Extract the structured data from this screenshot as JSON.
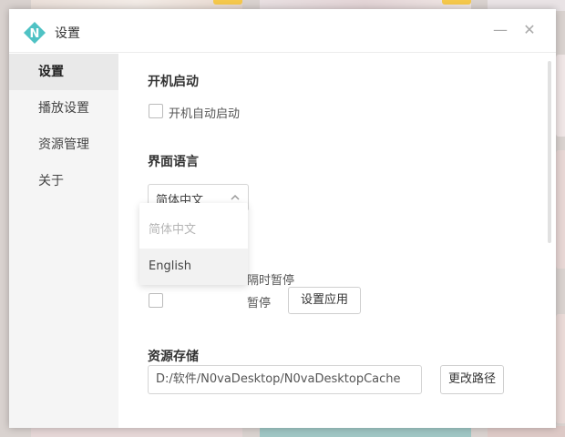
{
  "window": {
    "title": "设置",
    "minimize_symbol": "—",
    "close_symbol": "✕"
  },
  "sidebar": {
    "items": [
      {
        "label": "设置"
      },
      {
        "label": "播放设置"
      },
      {
        "label": "资源管理"
      },
      {
        "label": "关于"
      }
    ]
  },
  "startup": {
    "title": "开机启动",
    "checkbox_label": "开机自动启动"
  },
  "language": {
    "title": "界面语言",
    "selected": "简体中文",
    "options": [
      "简体中文",
      "English"
    ]
  },
  "pause": {
    "option1_visible_label": "隔时暂停",
    "option2_visible_label": "暂停",
    "apply_button": "设置应用"
  },
  "storage": {
    "title": "资源存储",
    "path": "D:/软件/N0vaDesktop/N0vaDesktopCache",
    "change_button": "更改路径"
  },
  "colors": {
    "logo_teal": "#4fc2c4",
    "sidebar_bg": "#f5f5f5",
    "active_bg": "#e9e9e9"
  }
}
